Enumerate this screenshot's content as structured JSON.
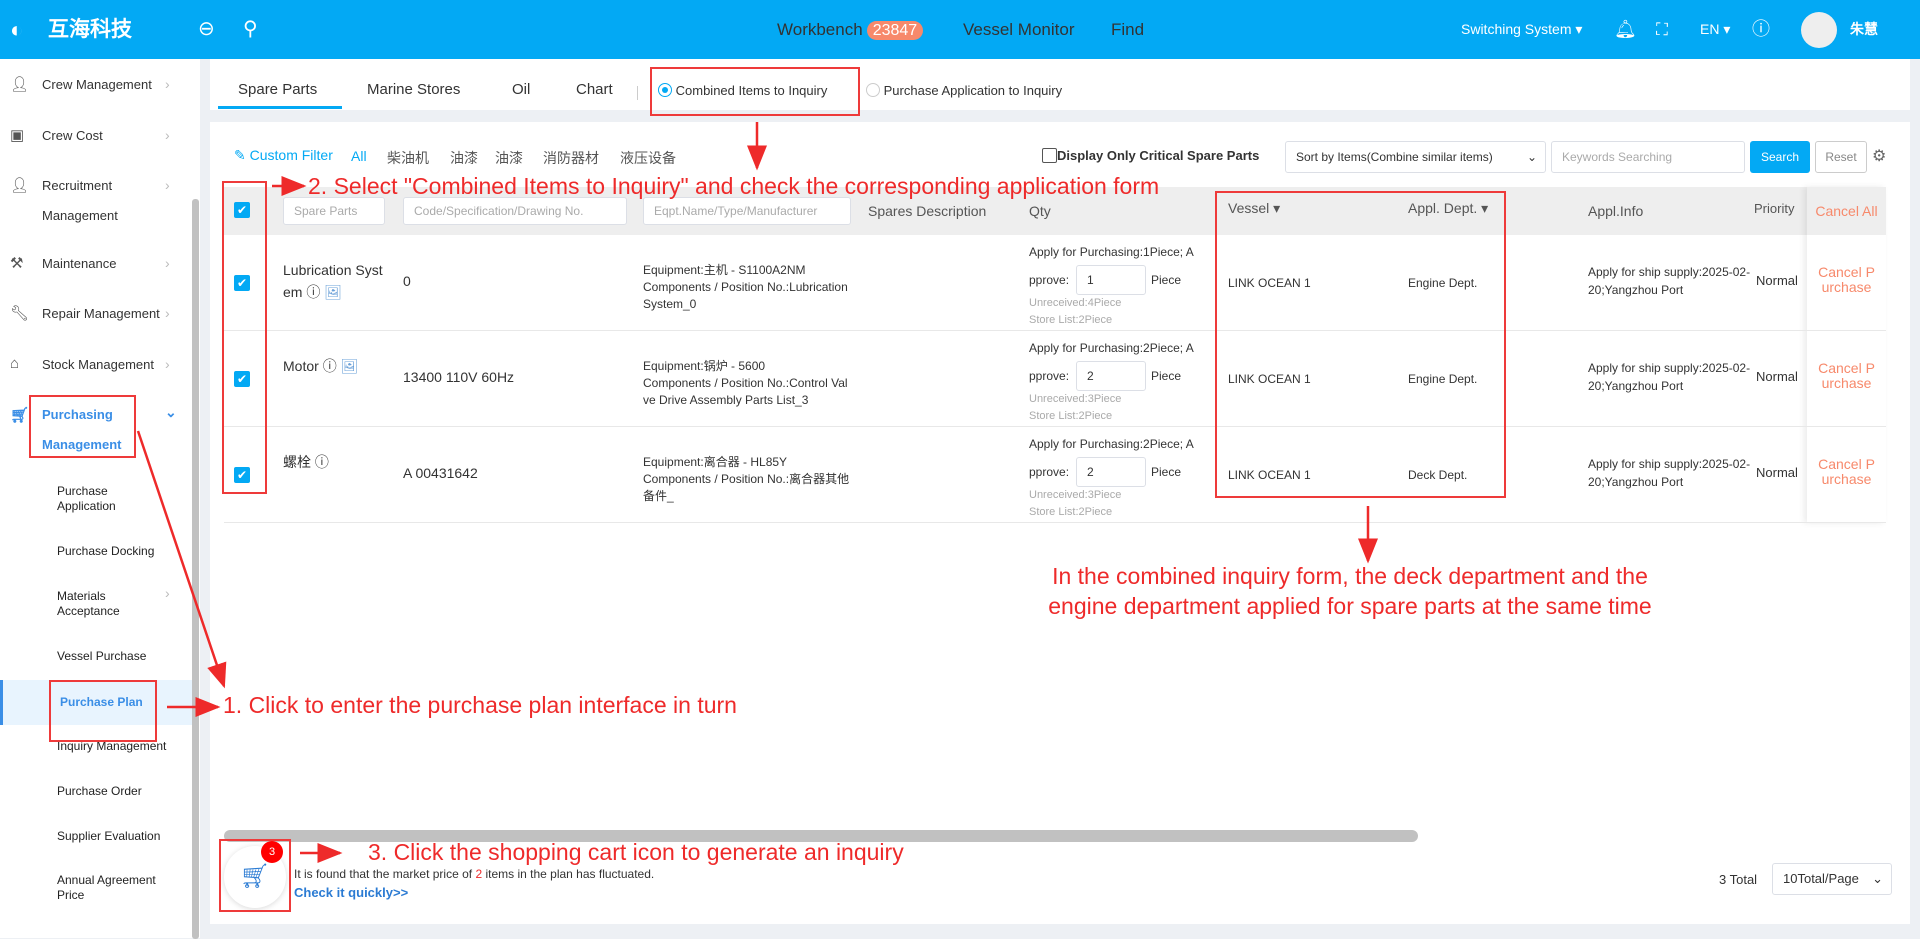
{
  "header": {
    "logo": "互海科技",
    "nav": [
      {
        "label": "Workbench",
        "badge": "23847"
      },
      {
        "label": "Vessel Monitor"
      },
      {
        "label": "Find"
      }
    ],
    "switch_system": "Switching System",
    "lang": "EN",
    "user": "朱慧"
  },
  "sidebar": {
    "items": [
      {
        "label": "Crew Management",
        "icon": "user-icon"
      },
      {
        "label": "Crew Cost",
        "icon": "wallet-icon"
      },
      {
        "label": "Recruitment Management",
        "l1": "Recruitment",
        "l2": "Management",
        "icon": "user-plus-icon"
      },
      {
        "label": "Maintenance",
        "icon": "wrench-icon"
      },
      {
        "label": "Repair Management",
        "icon": "tool-icon"
      },
      {
        "label": "Stock Management",
        "icon": "warehouse-icon"
      }
    ],
    "purchasing": {
      "l1": "Purchasing",
      "l2": "Management",
      "icon": "cart-icon"
    },
    "sub": [
      {
        "l1": "Purchase",
        "l2": "Application"
      },
      {
        "l1": "Purchase Docking"
      },
      {
        "l1": "Materials",
        "l2": "Acceptance"
      },
      {
        "l1": "Vessel Purchase"
      },
      {
        "l1": "Purchase Plan",
        "active": true
      },
      {
        "l1": "Inquiry Management"
      },
      {
        "l1": "Purchase Order"
      },
      {
        "l1": "Supplier Evaluation"
      },
      {
        "l1": "Annual Agreement",
        "l2": "Price"
      }
    ]
  },
  "tabs": [
    "Spare Parts",
    "Marine Stores",
    "Oil",
    "Chart"
  ],
  "radios": {
    "combined": "Combined Items to Inquiry",
    "application": "Purchase Application to Inquiry",
    "selected": "combined"
  },
  "filter": {
    "custom": "Custom Filter",
    "cats": [
      "All",
      "柴油机",
      "油漆",
      "油漆",
      "消防器材",
      "液压设备"
    ],
    "critical": "Display Only Critical Spare Parts",
    "sort": "Sort by Items(Combine similar items)",
    "keywords_placeholder": "Keywords Searching",
    "search": "Search",
    "reset": "Reset"
  },
  "table": {
    "headers": {
      "spare": "Spare Parts",
      "code": "Code/Specification/Drawing No.",
      "eqpt": "Eqpt.Name/Type/Manufacturer",
      "desc": "Spares Description",
      "qty": "Qty",
      "vessel": "Vessel",
      "dept": "Appl. Dept.",
      "info": "Appl.Info",
      "priority": "Priority",
      "cancel_all": "Cancel All"
    },
    "rows": [
      {
        "name1": "Lubrication Syst",
        "name2": "em",
        "code": "0",
        "eq1": "Equipment:主机 - S1100A2NM",
        "eq2": "Components / Position No.:Lubrication",
        "eq3": "System_0",
        "apply": "Apply for Purchasing:1Piece; A",
        "approve_label": "pprove:",
        "approve": "1",
        "unit": "Piece",
        "unrec": "Unreceived:4Piece",
        "store": "Store List:2Piece",
        "vessel": "LINK OCEAN 1",
        "dept": "Engine Dept.",
        "info1": "Apply for ship supply:2025-02-",
        "info2": "20;Yangzhou Port",
        "priority": "Normal",
        "c1": "Cancel P",
        "c2": "urchase",
        "img": true
      },
      {
        "name1": "Motor",
        "name2": "",
        "code": "13400 110V 60Hz",
        "eq1": "Equipment:锅炉 - 5600",
        "eq2": "Components / Position No.:Control Val",
        "eq3": "ve Drive Assembly Parts List_3",
        "apply": "Apply for Purchasing:2Piece; A",
        "approve_label": "pprove:",
        "approve": "2",
        "unit": "Piece",
        "unrec": "Unreceived:3Piece",
        "store": "Store List:2Piece",
        "vessel": "LINK OCEAN 1",
        "dept": "Engine Dept.",
        "info1": "Apply for ship supply:2025-02-",
        "info2": "20;Yangzhou Port",
        "priority": "Normal",
        "c1": "Cancel P",
        "c2": "urchase",
        "img": true
      },
      {
        "name1": "螺栓",
        "name2": "",
        "code": "A 00431642",
        "eq1": "Equipment:离合器 - HL85Y",
        "eq2": "Components / Position No.:离合器其他",
        "eq3": "备件_",
        "apply": "Apply for Purchasing:2Piece; A",
        "approve_label": "pprove:",
        "approve": "2",
        "unit": "Piece",
        "unrec": "Unreceived:3Piece",
        "store": "Store List:2Piece",
        "vessel": "LINK OCEAN 1",
        "dept": "Deck Dept.",
        "info1": "Apply for ship supply:2025-02-",
        "info2": "20;Yangzhou Port",
        "priority": "Normal",
        "c1": "Cancel P",
        "c2": "urchase",
        "img": false
      }
    ]
  },
  "footer": {
    "cart_count": "3",
    "notice_pre": "It is found that the market price of ",
    "notice_num": "2",
    "notice_post": " items in the plan has fluctuated.",
    "check": "Check it quickly>>",
    "total": "3 Total",
    "page_size": "10Total/Page"
  },
  "annotations": {
    "step1": "1. Click to enter the purchase plan interface in turn",
    "step2": "2. Select \"Combined Items to Inquiry\" and check the corresponding application form",
    "step3": "3. Click the shopping cart icon to generate an inquiry",
    "note1": "In the combined inquiry form, the deck department and the",
    "note2": "engine department applied for spare parts at the same time",
    "color": "#ee2a2a"
  }
}
